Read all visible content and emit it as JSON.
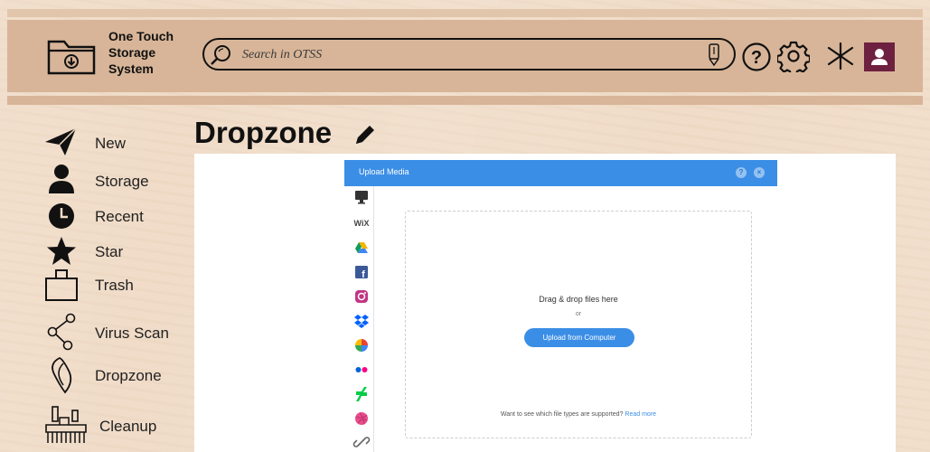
{
  "app": {
    "logo_text": "One Touch\nStorage\nSystem"
  },
  "search": {
    "placeholder": "Search in OTSS"
  },
  "header_icons": [
    "folder-download-icon",
    "search-icon",
    "microphone-icon",
    "help-icon",
    "gear-icon",
    "wix-logo-icon",
    "user-avatar-icon"
  ],
  "sidebar": {
    "items": [
      {
        "label": "New",
        "icon": "paper-plane-icon"
      },
      {
        "label": "Storage",
        "icon": "person-icon"
      },
      {
        "label": "Recent",
        "icon": "clock-icon"
      },
      {
        "label": "Star",
        "icon": "star-icon"
      },
      {
        "label": "Trash",
        "icon": "trash-icon"
      },
      {
        "label": "Virus Scan",
        "icon": "share-nodes-icon"
      },
      {
        "label": "Dropzone",
        "icon": "dropzone-icon"
      },
      {
        "label": "Cleanup",
        "icon": "brush-icon"
      }
    ]
  },
  "page": {
    "title": "Dropzone"
  },
  "upload_dialog": {
    "title": "Upload Media",
    "help_label": "?",
    "close_label": "×",
    "sources": [
      "monitor-icon",
      "wix-icon",
      "google-drive-icon",
      "facebook-icon",
      "instagram-icon",
      "dropbox-icon",
      "google-photos-icon",
      "flickr-icon",
      "deviantart-icon",
      "dribbble-icon",
      "link-icon"
    ],
    "wix_label": "WiX",
    "drag_text": "Drag & drop files here",
    "or_text": "or",
    "upload_button": "Upload from Computer",
    "types_question": "Want to see which file types are supported?",
    "read_more": "Read more"
  },
  "colors": {
    "header": "#d8b598",
    "accent": "#3b8ee6",
    "avatar": "#6e2040"
  }
}
